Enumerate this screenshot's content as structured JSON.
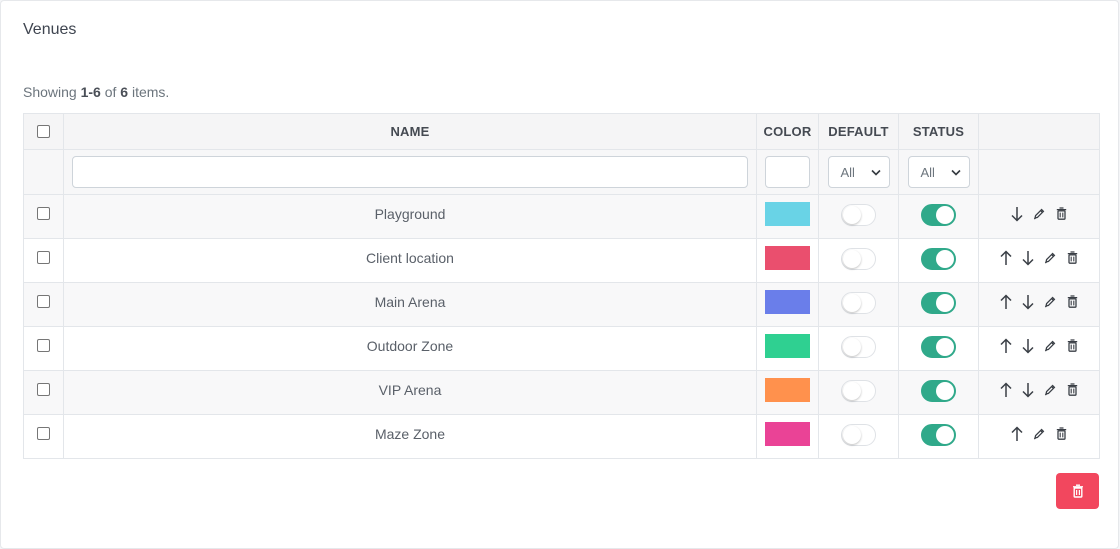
{
  "page": {
    "title": "Venues"
  },
  "summary": {
    "prefix": "Showing ",
    "range": "1-6",
    "of": " of ",
    "total": "6",
    "suffix": " items."
  },
  "table": {
    "columns": {
      "name": "NAME",
      "color": "COLOR",
      "default": "DEFAULT",
      "status": "STATUS"
    },
    "filters": {
      "name_value": "",
      "color_value": "",
      "default_selected": "All",
      "status_selected": "All"
    },
    "rows": [
      {
        "name": "Playground",
        "color": "#69d3e6",
        "default": false,
        "status": true,
        "can_move_up": false,
        "can_move_down": true
      },
      {
        "name": "Client location",
        "color": "#ea4f6e",
        "default": false,
        "status": true,
        "can_move_up": true,
        "can_move_down": true
      },
      {
        "name": "Main Arena",
        "color": "#6a7eea",
        "default": false,
        "status": true,
        "can_move_up": true,
        "can_move_down": true
      },
      {
        "name": "Outdoor Zone",
        "color": "#2fd091",
        "default": false,
        "status": true,
        "can_move_up": true,
        "can_move_down": true
      },
      {
        "name": "VIP Arena",
        "color": "#ff914d",
        "default": false,
        "status": true,
        "can_move_up": true,
        "can_move_down": true
      },
      {
        "name": "Maze Zone",
        "color": "#ea4396",
        "default": false,
        "status": true,
        "can_move_up": true,
        "can_move_down": false
      }
    ]
  },
  "icons": {
    "move_up": "arrow-up-icon",
    "move_down": "arrow-down-icon",
    "edit": "pencil-icon",
    "delete": "trash-icon",
    "bulk_delete": "trash-icon"
  },
  "colors": {
    "danger": "#f2475e",
    "toggle_on": "#30a98a"
  }
}
